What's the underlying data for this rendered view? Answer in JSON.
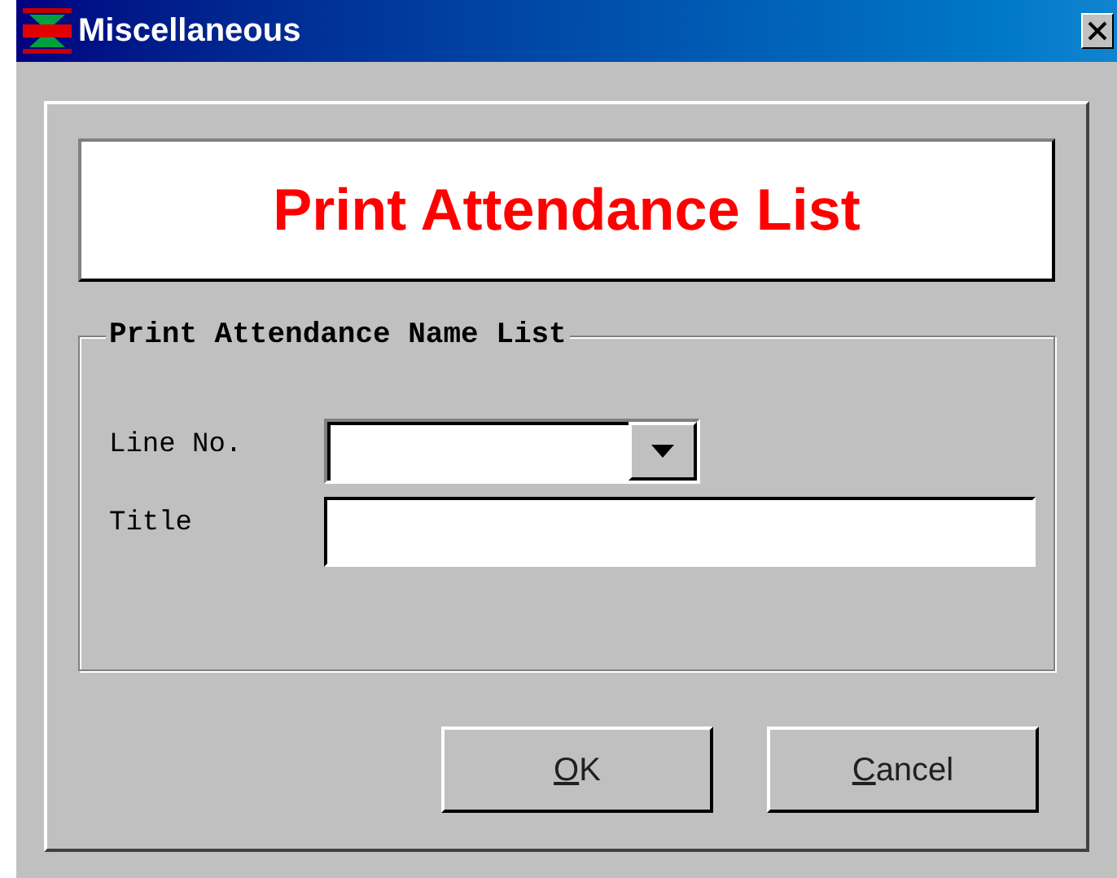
{
  "window": {
    "title": "Miscellaneous"
  },
  "header": {
    "text": "Print Attendance List"
  },
  "group": {
    "legend": "Print Attendance Name List",
    "fields": [
      {
        "kind": "combo",
        "label": "Line No."
      },
      {
        "kind": "text",
        "label": "Title"
      }
    ]
  },
  "buttons": [
    {
      "label": "OK",
      "first_letter_underlined": true
    },
    {
      "label": "Cancel",
      "first_letter_underlined": true
    }
  ]
}
